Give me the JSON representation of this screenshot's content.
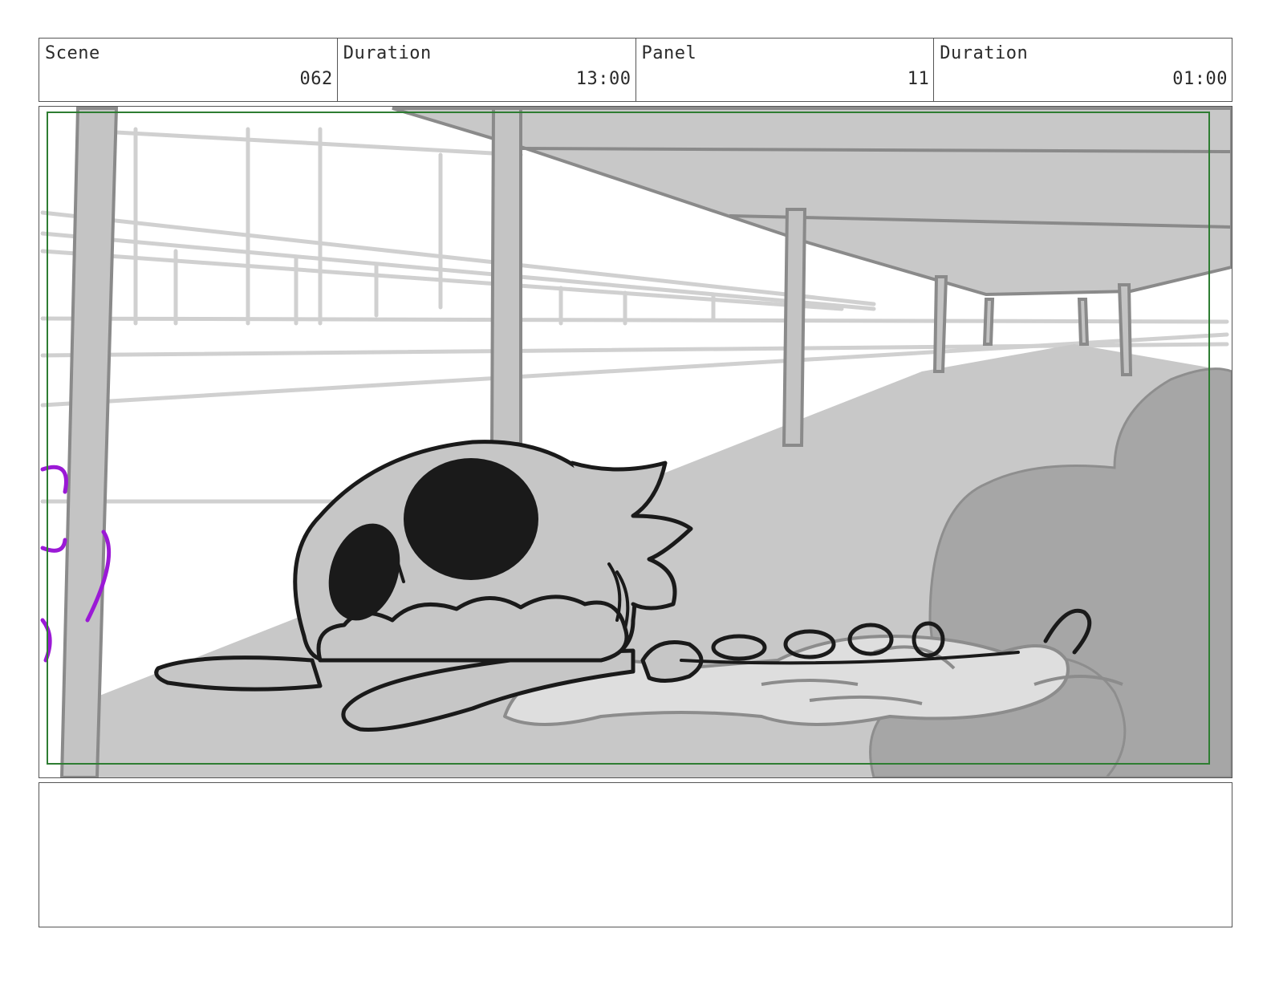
{
  "header": {
    "scene_label": "Scene",
    "scene_value": "062",
    "scene_duration_label": "Duration",
    "scene_duration_value": "13:00",
    "panel_label": "Panel",
    "panel_value": "11",
    "panel_duration_label": "Duration",
    "panel_duration_value": "01:00"
  },
  "panel": {
    "description": "",
    "frame_color": "#2e7d32",
    "ink_color": "#1a1a1a",
    "accent_color": "#9b19d6"
  },
  "notes": {
    "text": ""
  }
}
